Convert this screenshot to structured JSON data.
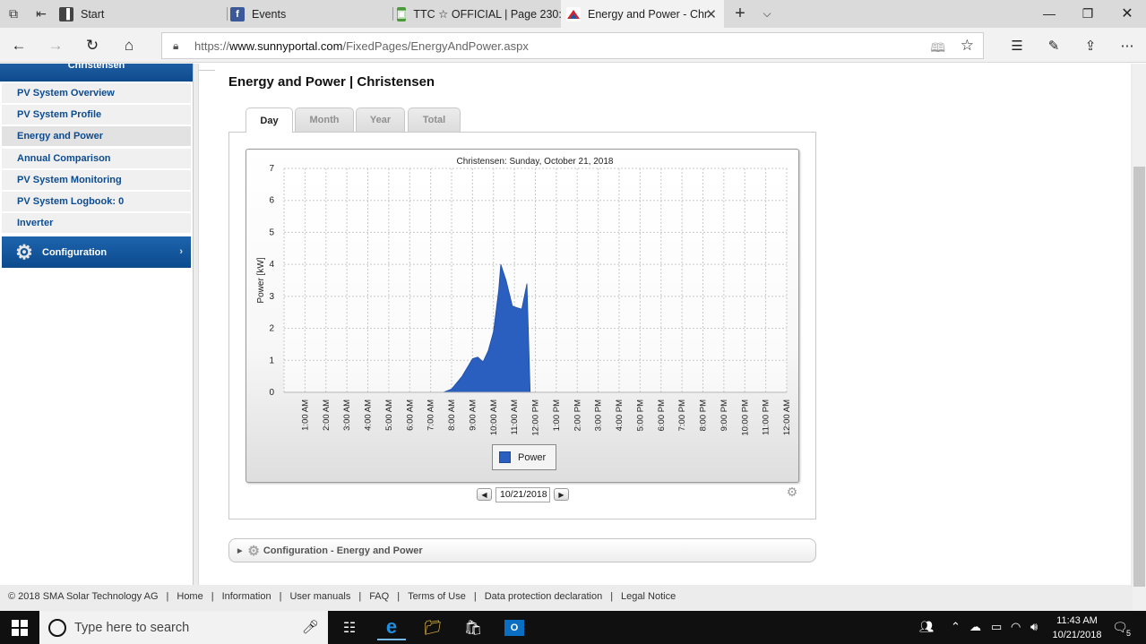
{
  "browser": {
    "tabs": [
      {
        "label": "Start",
        "icon": "start-page-icon",
        "active": false
      },
      {
        "label": "Events",
        "icon": "facebook-icon",
        "active": false
      },
      {
        "label": "TTC ☆ OFFICIAL | Page 230:",
        "icon": "forum-icon",
        "active": false
      },
      {
        "label": "Energy and Power - Chr",
        "icon": "sunnyportal-icon",
        "active": true
      }
    ],
    "url_prefix": "https://",
    "url_domain": "www.sunnyportal.com",
    "url_path": "/FixedPages/EnergyAndPower.aspx"
  },
  "sidebar": {
    "header": "Christensen",
    "items": [
      {
        "label": "PV System Overview"
      },
      {
        "label": "PV System Profile"
      },
      {
        "label": "Energy and Power",
        "active": true
      },
      {
        "label": "Annual Comparison"
      },
      {
        "label": "PV System Monitoring"
      },
      {
        "label": "PV System Logbook: 0"
      },
      {
        "label": "Inverter"
      }
    ],
    "config_label": "Configuration"
  },
  "main": {
    "title": "Energy and Power | Christensen",
    "tabs": [
      {
        "label": "Day",
        "active": true
      },
      {
        "label": "Month"
      },
      {
        "label": "Year"
      },
      {
        "label": "Total"
      }
    ],
    "date_value": "10/21/2018",
    "config_section": "Configuration - Energy and Power"
  },
  "chart_data": {
    "type": "area",
    "title": "Christensen: Sunday, October 21, 2018",
    "ylabel": "Power [kW]",
    "xlabel": "",
    "ylim": [
      0,
      7
    ],
    "yticks": [
      "0",
      "1",
      "2",
      "3",
      "4",
      "5",
      "6",
      "7"
    ],
    "xticks": [
      "1:00 AM",
      "2:00 AM",
      "3:00 AM",
      "4:00 AM",
      "5:00 AM",
      "6:00 AM",
      "7:00 AM",
      "8:00 AM",
      "9:00 AM",
      "10:00 AM",
      "11:00 AM",
      "12:00 PM",
      "1:00 PM",
      "2:00 PM",
      "3:00 PM",
      "4:00 PM",
      "5:00 PM",
      "6:00 PM",
      "7:00 PM",
      "8:00 PM",
      "9:00 PM",
      "10:00 PM",
      "11:00 PM",
      "12:00 AM"
    ],
    "grid": true,
    "legend_position": "bottom-center",
    "series": [
      {
        "name": "Power",
        "color": "#2a5ebf",
        "points": [
          [
            0.0,
            0
          ],
          [
            7.6,
            0
          ],
          [
            8.0,
            0.1
          ],
          [
            8.5,
            0.5
          ],
          [
            9.0,
            1.05
          ],
          [
            9.25,
            1.1
          ],
          [
            9.5,
            0.95
          ],
          [
            9.75,
            1.3
          ],
          [
            10.0,
            1.9
          ],
          [
            10.25,
            3.2
          ],
          [
            10.35,
            4.0
          ],
          [
            10.6,
            3.5
          ],
          [
            10.9,
            2.7
          ],
          [
            11.1,
            2.65
          ],
          [
            11.35,
            2.6
          ],
          [
            11.6,
            3.4
          ],
          [
            11.75,
            0
          ],
          [
            24.0,
            0
          ]
        ]
      }
    ]
  },
  "footer": {
    "copyright": "© 2018 SMA Solar Technology AG",
    "links": [
      "Home",
      "Information",
      "User manuals",
      "FAQ",
      "Terms of Use",
      "Data protection declaration",
      "Legal Notice"
    ]
  },
  "taskbar": {
    "search_placeholder": "Type here to search",
    "time": "11:43 AM",
    "date": "10/21/2018",
    "notification_count": "5"
  }
}
